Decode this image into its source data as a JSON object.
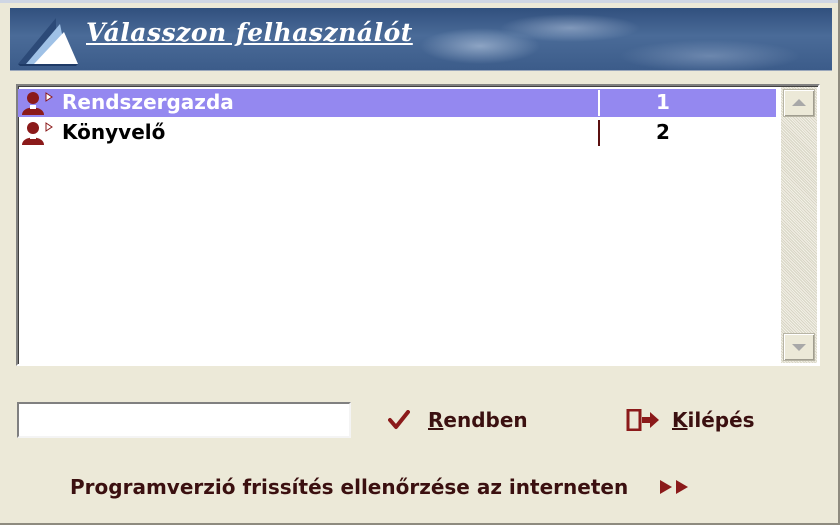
{
  "header": {
    "title": "Válasszon felhasználót"
  },
  "users": [
    {
      "name": "Rendszergazda",
      "id": "1",
      "selected": true
    },
    {
      "name": "Könyvelő",
      "id": "2",
      "selected": false
    }
  ],
  "input": {
    "value": ""
  },
  "buttons": {
    "ok_accel": "R",
    "ok_rest": "endben",
    "exit_accel": "K",
    "exit_rest": "ilépés"
  },
  "update_link": "Programverzió frissítés ellenőrzése az interneten",
  "icons": {
    "logo": "sail-logo-icon",
    "user": "user-icon",
    "ok": "checkmark-icon",
    "exit": "exit-door-icon",
    "update": "double-arrow-right-icon",
    "scroll_up": "arrow-up-icon",
    "scroll_down": "arrow-down-icon"
  },
  "colors": {
    "selection": "#9488f0",
    "accent_text": "#3b1010",
    "icon_red": "#8b1a1a",
    "header_blue": "#3c5c8a"
  }
}
